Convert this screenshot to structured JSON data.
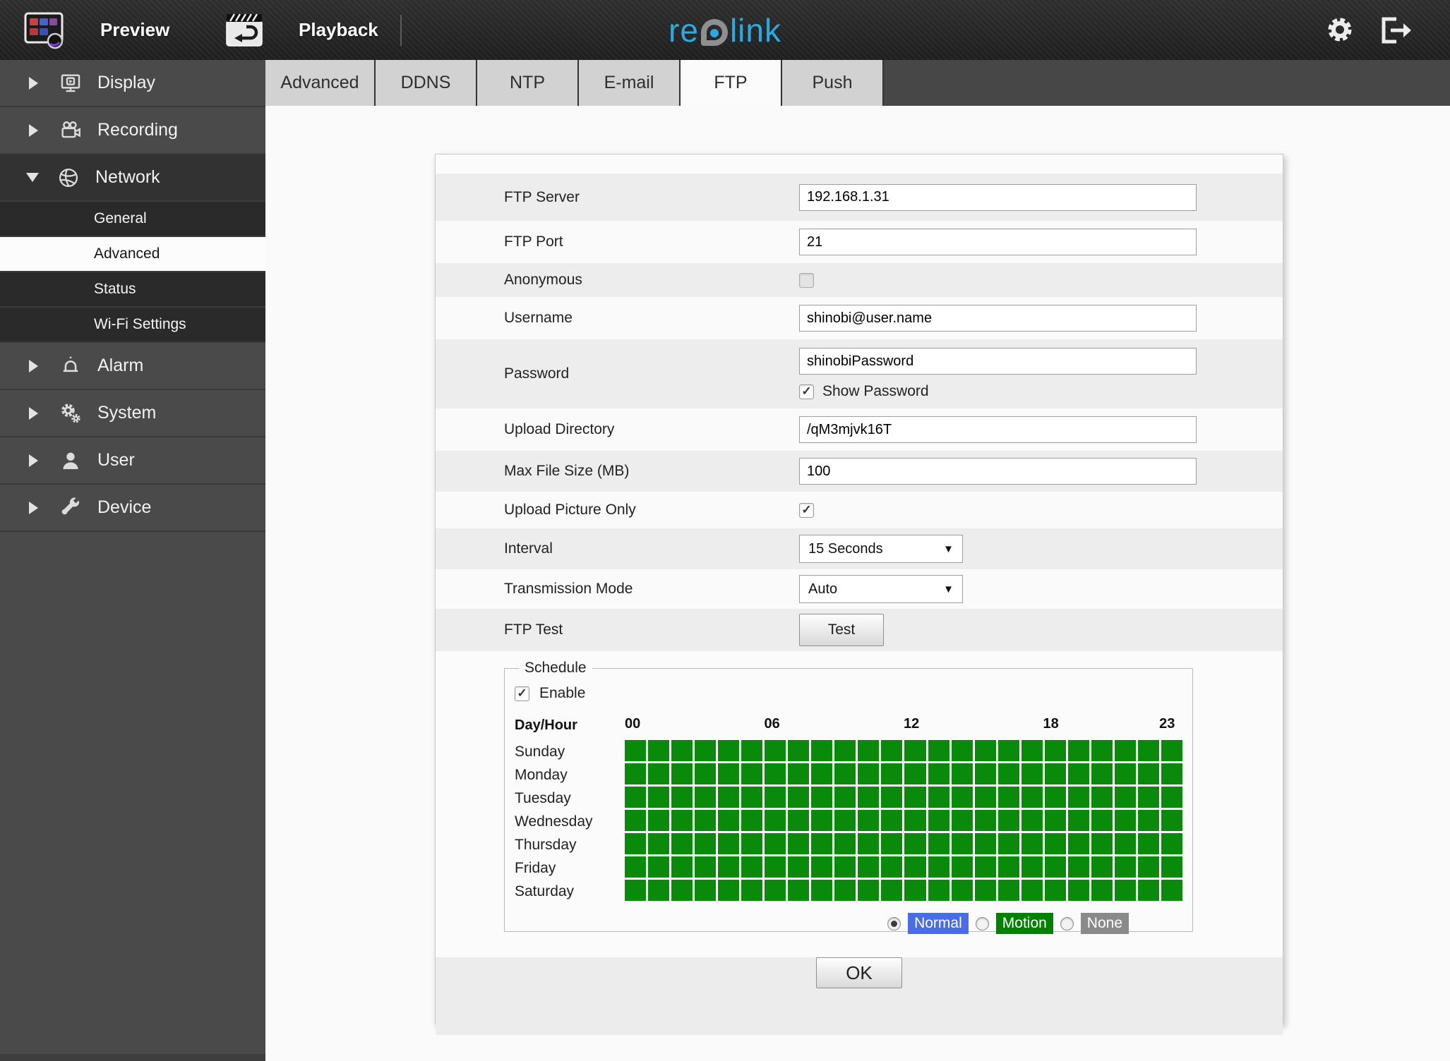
{
  "topbar": {
    "preview_label": "Preview",
    "playback_label": "Playback",
    "logo_prefix": "re",
    "logo_suffix": "link",
    "brand_color": "#2da9e2"
  },
  "sidebar": {
    "items": [
      {
        "label": "Display",
        "icon": "display-icon",
        "state": "collapsed"
      },
      {
        "label": "Recording",
        "icon": "recording-icon",
        "state": "collapsed"
      },
      {
        "label": "Network",
        "icon": "network-icon",
        "state": "expanded",
        "children": [
          "General",
          "Advanced",
          "Status",
          "Wi-Fi Settings"
        ],
        "selected_child": "Advanced"
      },
      {
        "label": "Alarm",
        "icon": "alarm-icon",
        "state": "collapsed"
      },
      {
        "label": "System",
        "icon": "system-icon",
        "state": "collapsed"
      },
      {
        "label": "User",
        "icon": "user-icon",
        "state": "collapsed"
      },
      {
        "label": "Device",
        "icon": "device-icon",
        "state": "collapsed"
      }
    ]
  },
  "tabs": {
    "items": [
      "Advanced",
      "DDNS",
      "NTP",
      "E-mail",
      "FTP",
      "Push"
    ],
    "active": "FTP"
  },
  "form": {
    "rows": [
      {
        "label": "FTP Server",
        "type": "text",
        "value": "192.168.1.31"
      },
      {
        "label": "FTP Port",
        "type": "text",
        "value": "21"
      },
      {
        "label": "Anonymous",
        "type": "checkbox",
        "checked": false
      },
      {
        "label": "Username",
        "type": "text",
        "value": "shinobi@user.name"
      },
      {
        "label": "Password",
        "type": "text",
        "value": "shinobiPassword",
        "extra_label": "Show Password",
        "extra_checked": true
      },
      {
        "label": "Upload Directory",
        "type": "text",
        "value": "/qM3mjvk16T"
      },
      {
        "label": "Max File Size (MB)",
        "type": "text",
        "value": "100"
      },
      {
        "label": "Upload Picture Only",
        "type": "checkbox",
        "checked": true
      },
      {
        "label": "Interval",
        "type": "select",
        "value": "15 Seconds"
      },
      {
        "label": "Transmission Mode",
        "type": "select",
        "value": "Auto"
      },
      {
        "label": "FTP Test",
        "type": "button",
        "value": "Test"
      }
    ],
    "ok_label": "OK"
  },
  "schedule": {
    "legend": "Schedule",
    "enable_label": "Enable",
    "enable_checked": true,
    "day_hour_label": "Day/Hour",
    "hour_marks": [
      "00",
      "06",
      "12",
      "18",
      "23"
    ],
    "hours_per_day": 24,
    "days": [
      "Sunday",
      "Monday",
      "Tuesday",
      "Wednesday",
      "Thursday",
      "Friday",
      "Saturday"
    ],
    "all_cells_value": "Motion",
    "cell_color": "#0a8a0a",
    "modes": [
      {
        "label": "Normal",
        "color": "#4a6ce4",
        "selected": true
      },
      {
        "label": "Motion",
        "color": "#028102",
        "selected": false
      },
      {
        "label": "None",
        "color": "#8a8a8a",
        "selected": false
      }
    ]
  }
}
